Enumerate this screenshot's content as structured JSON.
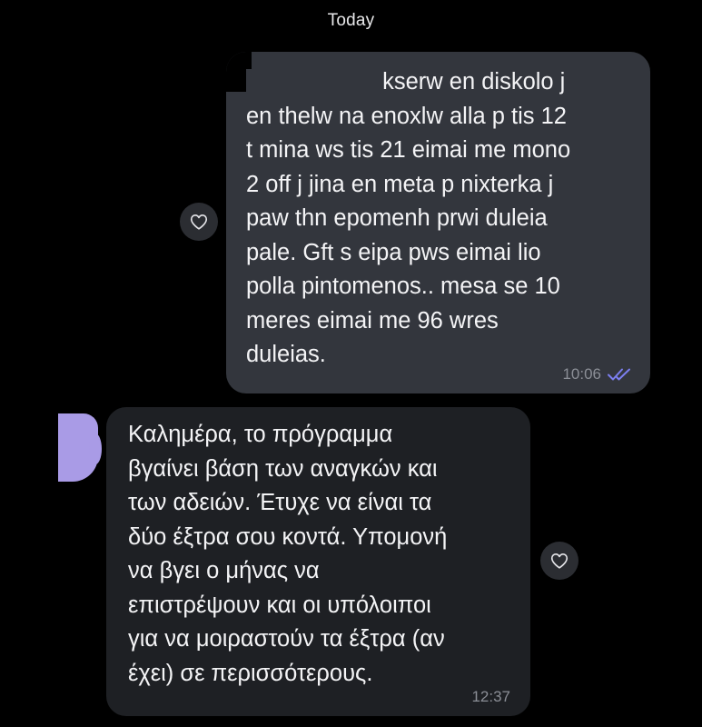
{
  "date_separator": "Today",
  "messages": [
    {
      "direction": "outgoing",
      "lines": [
        "kserw en diskolo j",
        "en thelw na enoxlw alla p tis 12",
        "t mina ws tis 21 eimai me mono",
        "2 off j jina en meta p nixterka j",
        "paw thn epomenh prwi duleia",
        "pale. Gft s eipa pws eimai lio",
        "polla pintomenos.. mesa se 10",
        "meres eimai me 96 wres",
        "duleias."
      ],
      "time": "10:06",
      "status_icon": "double-check-read-icon",
      "reaction_icon": "heart-outline-icon"
    },
    {
      "direction": "incoming",
      "lines": [
        "Καλημέρα, το πρόγραμμα",
        "βγαίνει βάση των αναγκών και",
        "των αδειών. Έτυχε να είναι τα",
        "δύο έξτρα σου κοντά. Υπομονή",
        "να βγει ο μήνας να",
        "επιστρέψουν και οι υπόλοιποι",
        "για να μοιραστούν τα έξτρα (αν",
        "έχει) σε περισσότερους."
      ],
      "time": "12:37",
      "reaction_icon": "heart-outline-icon"
    }
  ],
  "colors": {
    "background": "#000000",
    "outgoing_bubble": "#33363d",
    "incoming_bubble": "#1e2024",
    "read_ticks": "#7c7ff0",
    "timestamp": "#8b8e96",
    "avatar_redaction": "#a99be6"
  }
}
